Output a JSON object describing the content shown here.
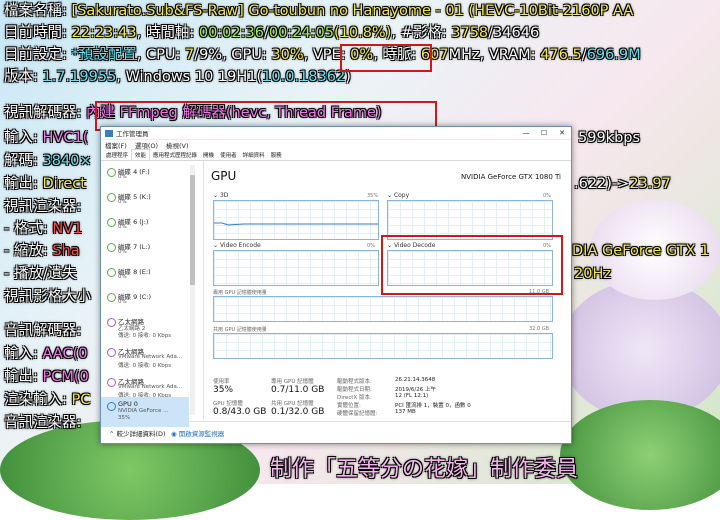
{
  "osd": {
    "l1": {
      "label": "檔案名稱: ",
      "value": "[Sakurato.Sub&FS-Raw] Go-toubun no Hanayome - 01 (HEVC-10Bit-2160P AA"
    },
    "l2": {
      "label": "目前時間: ",
      "time": "22:23:43",
      "mid": ", 時間軸: ",
      "pos": "00:02:36",
      "sep": "/",
      "dur": "00:24:05",
      "pct": "(10.8%)",
      "fr_label": ", #影格: ",
      "frame": "3758",
      "frame_sep": "/",
      "frames": "34646"
    },
    "l3": {
      "label": "目前設定: ",
      "preset": "*預設配置",
      "cpu_l": ", CPU: ",
      "cpu_v": "7",
      "cpu_s": "/9%",
      "gpu_l": ", GPU: ",
      "gpu_v": "30%",
      "vpe_l": ", VPE: ",
      "vpe_v": "0%",
      "clk_l": ", 時脈: ",
      "clk_v": "607",
      "clk_u": "MHz",
      "vram_l": ", VRAM: ",
      "vram_v": "476.5",
      "vram_s": "/",
      "vram_t": "696.9M"
    },
    "l4": {
      "label": "版本: ",
      "ver": "1.7.19955",
      "os": ", Windows 10 19H1(",
      "build": "10.0.18362",
      "close": ")"
    },
    "l5": {
      "label": "視訊解碼器: ",
      "value": "內建 FFmpeg 解碼器(hevc, Thread Frame)"
    },
    "l6": {
      "label": "輸入: ",
      "value": "HVC1(",
      "tail": "599kbps"
    },
    "l7": {
      "label": "解碼: ",
      "value": "3840×"
    },
    "l8": {
      "label": "輸出: ",
      "value": "Direct",
      "tail_a": ".622)->",
      "tail_b": "23.97"
    },
    "l9": {
      "label": "視訊渲染器: "
    },
    "l10": {
      "label": " - 格式: ",
      "value": "NV1"
    },
    "l11": {
      "label": " - 縮放: ",
      "value": "Sha",
      "tail": "DIA GeForce GTX 1"
    },
    "l12": {
      "label": " - 播放/遺失",
      "tail": "20Hz"
    },
    "l13": {
      "label": "視訊影格大小"
    },
    "l14": {
      "label": "音訊解碼器: "
    },
    "l15": {
      "label": "輸入: ",
      "value": "AAC(0"
    },
    "l16": {
      "label": "輸出: ",
      "value": "PCM(0"
    },
    "l17": {
      "label": "渲染輸入: ",
      "value": "PC"
    },
    "l18": {
      "label": "音訊渲染器: "
    },
    "subtitle": "制作「五等分の花嫁」制作委員"
  },
  "taskmgr": {
    "title": "工作管理員",
    "menu": [
      "檔案(F)",
      "選項(O)",
      "檢視(V)"
    ],
    "tabs": [
      "處理程序",
      "效能",
      "應用程式歷程記錄",
      "開機",
      "使用者",
      "詳細資料",
      "服務"
    ],
    "active_tab": "效能",
    "sidebar": [
      {
        "name": "磁碟 4 (F:)",
        "line2": "0%",
        "line3": ""
      },
      {
        "name": "磁碟 5 (K:)",
        "line2": "0%",
        "line3": ""
      },
      {
        "name": "磁碟 6 (J:)",
        "line2": "0%",
        "line3": ""
      },
      {
        "name": "磁碟 7 (L:)",
        "line2": "0%",
        "line3": ""
      },
      {
        "name": "磁碟 8 (E:)",
        "line2": "0%",
        "line3": ""
      },
      {
        "name": "磁碟 9 (C:)",
        "line2": "0%",
        "line3": ""
      },
      {
        "name": "乙太網路",
        "line2": "乙太網路 2",
        "line3": "傳送: 0 接收: 0 Kbps"
      },
      {
        "name": "乙太網路",
        "line2": "VMware Network Ada...",
        "line3": "傳送: 0 接收: 0 Kbps"
      },
      {
        "name": "乙太網路",
        "line2": "VMware Network Ada...",
        "line3": "傳送: 0 接收: 0 Kbps"
      },
      {
        "name": "GPU 0",
        "line2": "NVIDIA GeForce ...",
        "line3": "35%"
      }
    ],
    "footer": {
      "fewer": "較少詳細資料(D)",
      "monitor": "開啟資源監視器"
    },
    "gpu": {
      "heading": "GPU",
      "model": "NVIDIA GeForce GTX 1080 Ti",
      "engines": [
        {
          "name": "3D",
          "pct": "35%"
        },
        {
          "name": "Copy",
          "pct": "0%"
        },
        {
          "name": "Video Encode",
          "pct": "0%"
        },
        {
          "name": "Video Decode",
          "pct": "0%"
        }
      ],
      "dedicated_label": "專用 GPU 記憶體使用量",
      "dedicated_max": "11.0 GB",
      "shared_label": "共用 GPU 記憶體使用量",
      "shared_max": "32.0 GB",
      "stats": [
        {
          "label": "使用率",
          "value": "35%"
        },
        {
          "label": "專用 GPU 記憶體",
          "value": "0.7/11.0 GB"
        },
        {
          "label": "GPU 記憶體",
          "value": "0.8/43.0 GB"
        },
        {
          "label": "共用 GPU 記憶體",
          "value": "0.1/32.0 GB"
        }
      ],
      "details": [
        {
          "k": "驅動程式版本:",
          "v": "26.21.14.3648"
        },
        {
          "k": "驅動程式日期:",
          "v": "2019/6/26 上午"
        },
        {
          "k": "DirectX 版本:",
          "v": "12 (FL 12.1)"
        },
        {
          "k": "實體位置:",
          "v": "PCI 匯流排 1，裝置 0，函數 0"
        },
        {
          "k": "硬體保留記憶體:",
          "v": "137 MB"
        }
      ]
    }
  },
  "colors": {
    "highlight": "#d01818",
    "chart": "#3c7dc2",
    "yellow": "#f5e94a",
    "green": "#9ff04a",
    "cyan": "#67e0f0",
    "magenta": "#f07ae8"
  }
}
